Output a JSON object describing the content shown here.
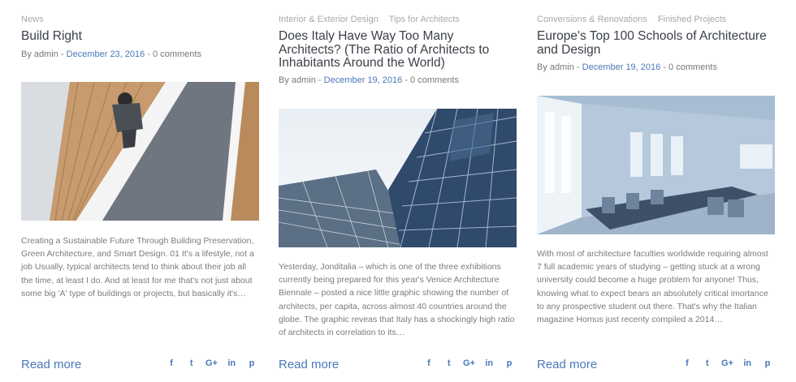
{
  "posts": [
    {
      "categories": [
        "News"
      ],
      "title": "Build Right",
      "meta_by": "By admin",
      "meta_sep1": " - ",
      "date": "December 23, 2016",
      "meta_sep2": " - ",
      "comments": "0 comments",
      "image_subject": "Overhead view of a man walking on a wooden staircase beside a concrete wall",
      "excerpt": "Creating a Sustainable Future Through Building Preservation, Green Architecture, and Smart Design. 01 It's a lifestyle, not a job Usually, typical architects tend to think about their job all the time, at least I do. And at least for me that's not just about some big 'A' type of buildings or projects, but basically it's…",
      "read_more": "Read more",
      "share_icons": [
        "f",
        "t",
        "G+",
        "in",
        "p"
      ]
    },
    {
      "categories": [
        "Interior & Exterior Design",
        "Tips for Architects"
      ],
      "title": "Does Italy Have Way Too Many Architects? (The Ratio of Architects to Inhabitants Around the World)",
      "meta_by": "By admin",
      "meta_sep1": " - ",
      "date": "December 19, 2016",
      "meta_sep2": " - ",
      "comments": "0 comments",
      "image_subject": "Low angle view of glass skyscrapers against a pale sky",
      "excerpt": "Yesterday, Jonditalia – which is one of the three exhibitions currently being prepared for this year's Venice Architecture Biennale – posted a nice little graphic showing the number of architects, per capita, across almost 40 countries around the globe. The graphic reveas that Italy has a shockingly high ratio of architects in correlation to its…",
      "read_more": "Read more",
      "share_icons": [
        "f",
        "t",
        "G+",
        "in",
        "p"
      ]
    },
    {
      "categories": [
        "Conversions & Renovations",
        "Finished Projects"
      ],
      "title": "Europe's Top 100 Schools of Architecture and Design",
      "meta_by": "By admin",
      "meta_sep1": " - ",
      "date": "December 19, 2016",
      "meta_sep2": " - ",
      "comments": "0 comments",
      "image_subject": "Bright empty conference room with a long table and chairs near tall windows",
      "excerpt": "With most of architecture faculties worldwide requiring almost 7 full academic years of studying – getting stuck at a wrong university could become a huge problem for anyone! Thus,  knowing what to expect bears an absolutely critical imortance to any prospective student out there. That's why the Italian magazine Homus just recenty compiled a 2014…",
      "read_more": "Read more",
      "share_icons": [
        "f",
        "t",
        "G+",
        "in",
        "p"
      ]
    }
  ],
  "colors": {
    "accent": "#4a78b9",
    "title": "#3b4048",
    "muted": "#a8a8a8",
    "body": "#7b7b7b"
  },
  "share_icon_names": [
    "facebook-icon",
    "twitter-icon",
    "google-plus-icon",
    "linkedin-icon",
    "pinterest-icon"
  ]
}
